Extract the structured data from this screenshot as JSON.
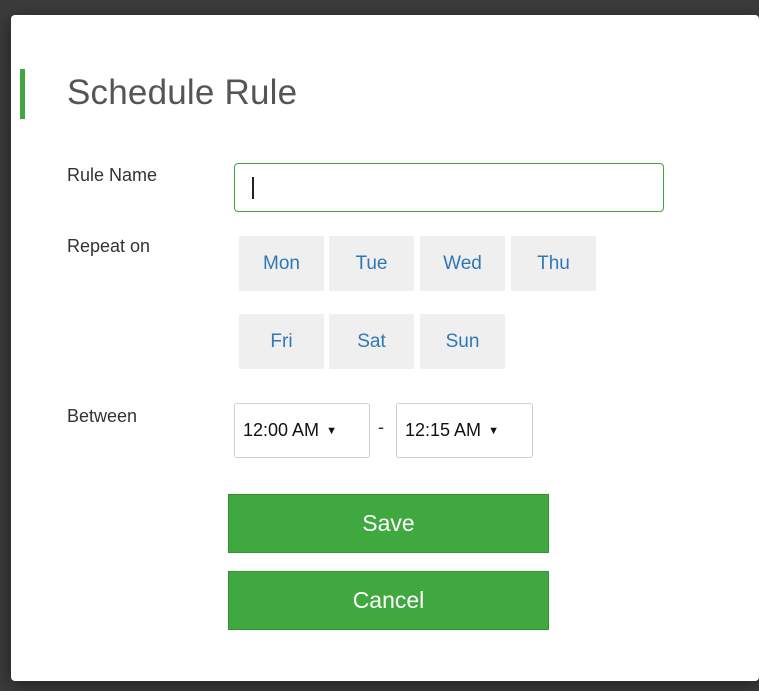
{
  "modal": {
    "title": "Schedule Rule"
  },
  "form": {
    "rule_name": {
      "label": "Rule Name",
      "value": "",
      "placeholder": ""
    },
    "repeat_on": {
      "label": "Repeat on",
      "days": [
        "Mon",
        "Tue",
        "Wed",
        "Thu",
        "Fri",
        "Sat",
        "Sun"
      ]
    },
    "between": {
      "label": "Between",
      "start": "12:00 AM",
      "separator": "-",
      "end": "12:15 AM",
      "arrow": "▼"
    }
  },
  "actions": {
    "save_label": "Save",
    "cancel_label": "Cancel"
  },
  "colors": {
    "accent": "#3fa83f",
    "day_text": "#2f78b7",
    "day_bg": "#efefef"
  }
}
